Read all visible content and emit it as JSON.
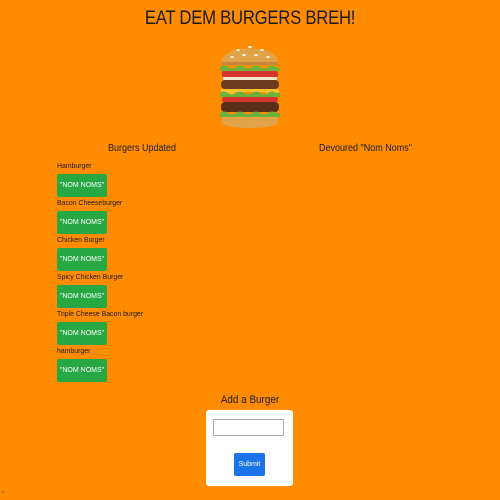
{
  "header": {
    "title": "EAT DEM BURGERS BREH!"
  },
  "hero_image": {
    "icon": "burger-icon"
  },
  "columns": {
    "left_heading": "Burgers Updated",
    "right_heading": "Devoured \"Nom Noms\""
  },
  "burgers": [
    {
      "name": "Hamburger",
      "button_label": "\"NOM NOMS\""
    },
    {
      "name": "Bacon Cheeseburger",
      "button_label": "\"NOM NOMS\""
    },
    {
      "name": "Chicken Burger",
      "button_label": "\"NOM NOMS\""
    },
    {
      "name": "Spicy Chicken Burger",
      "button_label": "\"NOM NOMS\""
    },
    {
      "name": "Triple Cheese Bacon burger",
      "button_label": "\"NOM NOMS\""
    },
    {
      "name": "hamburger",
      "button_label": "\"NOM NOMS\""
    }
  ],
  "devoured": [],
  "add_form": {
    "heading": "Add a Burger",
    "input_value": "",
    "input_placeholder": "",
    "submit_label": "Submit"
  },
  "colors": {
    "background": "#ff8c00",
    "devour_button": "#28a745",
    "submit_button": "#1a73e8"
  }
}
